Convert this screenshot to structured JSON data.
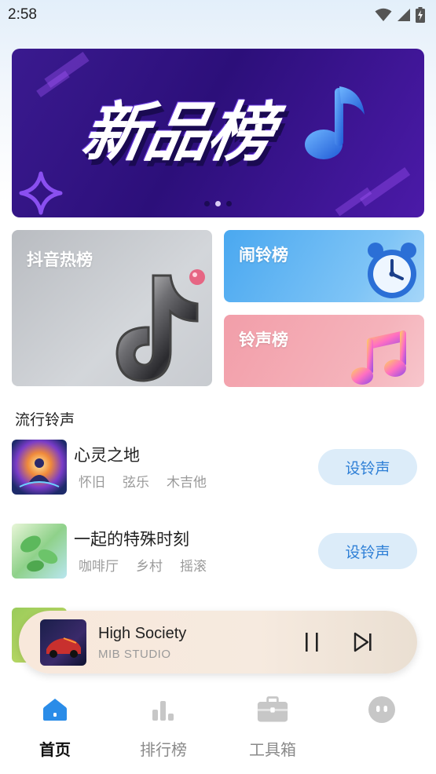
{
  "status_bar": {
    "time": "2:58"
  },
  "banner": {
    "title": "新品榜",
    "dots": 3,
    "active_dot": 1
  },
  "categories": [
    {
      "label": "抖音热榜"
    },
    {
      "label": "闹铃榜"
    },
    {
      "label": "铃声榜"
    }
  ],
  "section": {
    "title": "流行铃声"
  },
  "songs": [
    {
      "name": "心灵之地",
      "tags": [
        "怀旧",
        "弦乐",
        "木吉他"
      ],
      "button": "设铃声"
    },
    {
      "name": "一起的特殊时刻",
      "tags": [
        "咖啡厅",
        "乡村",
        "摇滚"
      ],
      "button": "设铃声"
    }
  ],
  "player": {
    "title": "High Society",
    "artist": "MIB STUDIO",
    "state": "playing"
  },
  "tabs": [
    {
      "label": "首页",
      "icon": "home-icon",
      "active": true
    },
    {
      "label": "排行榜",
      "icon": "bar-chart-icon",
      "active": false
    },
    {
      "label": "工具箱",
      "icon": "toolbox-icon",
      "active": false
    },
    {
      "label": "",
      "icon": "profile-icon",
      "active": false
    }
  ],
  "colors": {
    "accent": "#2e7fd6",
    "button_bg": "#dcecf9",
    "banner_bg": "#3a1a8f",
    "alarm_card": "#4aa8f0",
    "ringtone_card": "#f29ea9"
  }
}
